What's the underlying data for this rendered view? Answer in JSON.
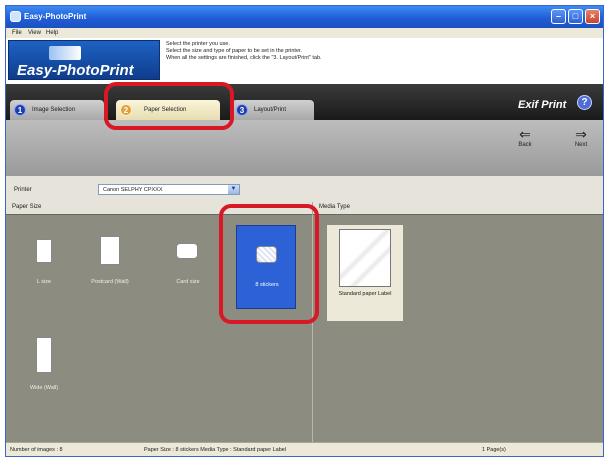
{
  "window": {
    "title": "Easy-PhotoPrint",
    "controls": [
      "–",
      "□",
      "×"
    ]
  },
  "menu": [
    "File",
    "View",
    "Help"
  ],
  "header": {
    "logo_text": "Easy-PhotoPrint",
    "instructions": [
      "Select the printer you use.",
      "Select the size and type of paper to be set in the printer.",
      "When all the settings are finished, click the \"3. Layout/Print\" tab."
    ]
  },
  "tabs": [
    {
      "number": "1",
      "label": "Image Selection",
      "state": "inactive"
    },
    {
      "number": "2",
      "label": "Paper Selection",
      "state": "active"
    },
    {
      "number": "3",
      "label": "Layout/Print",
      "state": "inactive"
    }
  ],
  "exif_logo": "Exif Print",
  "help_label": "?",
  "nav": {
    "back_label": "Back",
    "next_label": "Next"
  },
  "printer": {
    "label": "Printer",
    "value": "Canon SELPHY CPXXX"
  },
  "paper_size": {
    "heading": "Paper Size",
    "items": [
      {
        "label": "L size",
        "icon": "paper-portrait-icon",
        "selected": false
      },
      {
        "label": "Postcard (Wall)",
        "icon": "paper-portrait-icon",
        "selected": false
      },
      {
        "label": "Card size",
        "icon": "paper-card-icon",
        "selected": false
      },
      {
        "label": "8 stickers",
        "icon": "sticker-sheet-icon",
        "selected": true
      },
      {
        "label": "Wide (Wall)",
        "icon": "paper-wide-icon",
        "selected": false
      }
    ]
  },
  "media_type": {
    "heading": "Media Type",
    "items": [
      {
        "label": "Standard paper Label",
        "icon": "label-paper-icon",
        "selected": true
      }
    ]
  },
  "status": {
    "images": "Number of images : 8",
    "settings": "Paper Size : 8 stickers  Media Type : Standard paper Label",
    "pages": "1 Page(s)"
  },
  "colors": {
    "titlebar": "#245edb",
    "selection": "#2c62d6",
    "callout": "#d81925",
    "active_tab": "#e0a040"
  }
}
